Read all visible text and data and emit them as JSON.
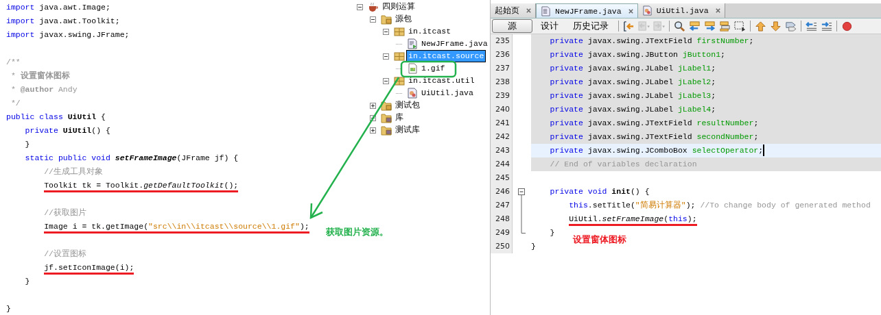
{
  "left_code": {
    "lines": [
      {
        "underlined": false,
        "tokens": [
          {
            "kind": "keyword",
            "text": "import"
          },
          {
            "kind": "text",
            "text": " java.awt.Image;"
          }
        ]
      },
      {
        "underlined": false,
        "tokens": [
          {
            "kind": "keyword",
            "text": "import"
          },
          {
            "kind": "text",
            "text": " java.awt.Toolkit;"
          }
        ]
      },
      {
        "underlined": false,
        "tokens": [
          {
            "kind": "keyword",
            "text": "import"
          },
          {
            "kind": "text",
            "text": " javax.swing.JFrame;"
          }
        ]
      },
      {
        "kind": "blank"
      },
      {
        "kind": "code",
        "underlined": false,
        "tokens": [
          {
            "kind": "comment",
            "text": "/**"
          }
        ]
      },
      {
        "underlined": false,
        "tokens": [
          {
            "kind": "comment",
            "text": " * "
          },
          {
            "kind": "comment-bold",
            "text": "设置窗体图标"
          }
        ]
      },
      {
        "underlined": false,
        "tokens": [
          {
            "kind": "comment",
            "text": " * "
          },
          {
            "kind": "comment-bold",
            "text": "@author"
          },
          {
            "kind": "comment",
            "text": " Andy"
          }
        ]
      },
      {
        "underlined": false,
        "tokens": [
          {
            "kind": "comment",
            "text": " */"
          }
        ]
      },
      {
        "underlined": false,
        "tokens": [
          {
            "kind": "keyword",
            "text": "public class "
          },
          {
            "kind": "bold",
            "text": "UiUtil"
          },
          {
            "kind": "text",
            "text": " {"
          }
        ]
      },
      {
        "underlined": false,
        "tokens": [
          {
            "kind": "keyword",
            "text": "    private "
          },
          {
            "kind": "bold",
            "text": "UiUtil"
          },
          {
            "kind": "text",
            "text": "() {"
          }
        ]
      },
      {
        "underlined": false,
        "tokens": [
          {
            "kind": "text",
            "text": "    }"
          }
        ]
      },
      {
        "underlined": false,
        "tokens": [
          {
            "kind": "keyword",
            "text": "    static public void "
          },
          {
            "kind": "bold-italic",
            "text": "setFrameImage"
          },
          {
            "kind": "text",
            "text": "(JFrame jf) {"
          }
        ]
      },
      {
        "underlined": false,
        "tokens": [
          {
            "kind": "comment",
            "text": "        //生成工具对象"
          }
        ]
      },
      {
        "underlined": true,
        "tokens": [
          {
            "kind": "text",
            "text": "        Toolkit tk = Toolkit."
          },
          {
            "kind": "italic",
            "text": "getDefaultToolkit"
          },
          {
            "kind": "text",
            "text": "();"
          }
        ]
      },
      {
        "kind": "blank"
      },
      {
        "kind": "code",
        "underlined": false,
        "tokens": [
          {
            "kind": "comment",
            "text": "        //获取图片"
          }
        ]
      },
      {
        "underlined": true,
        "tokens": [
          {
            "kind": "text",
            "text": "        Image i = tk.getImage("
          },
          {
            "kind": "string",
            "text": "\"src\\\\in\\\\itcast\\\\source\\\\1.gif\""
          },
          {
            "kind": "text",
            "text": ");"
          }
        ]
      },
      {
        "kind": "blank"
      },
      {
        "kind": "code",
        "underlined": false,
        "tokens": [
          {
            "kind": "comment",
            "text": "        //设置图标"
          }
        ]
      },
      {
        "underlined": true,
        "tokens": [
          {
            "kind": "text",
            "text": "        jf.setIconImage(i);"
          }
        ]
      },
      {
        "underlined": false,
        "tokens": [
          {
            "kind": "text",
            "text": "    }"
          }
        ]
      },
      {
        "kind": "blank"
      },
      {
        "kind": "code",
        "underlined": false,
        "tokens": [
          {
            "kind": "text",
            "text": "}"
          }
        ]
      }
    ]
  },
  "project_tree": [
    {
      "label": "四则运算",
      "kind": "project",
      "expanded": true,
      "selected": false,
      "children": [
        {
          "label": "源包",
          "kind": "source-folder",
          "expanded": true,
          "selected": false,
          "children": [
            {
              "label": "in.itcast",
              "kind": "package",
              "expanded": true,
              "selected": false,
              "children": [
                {
                  "label": "NewJFrame.java",
                  "kind": "form-file",
                  "selected": false
                }
              ]
            },
            {
              "label": "in.itcast.source",
              "kind": "package",
              "expanded": true,
              "selected": true,
              "children": [
                {
                  "label": "1.gif",
                  "kind": "image-file",
                  "selected": false
                }
              ]
            },
            {
              "label": "in.itcast.util",
              "kind": "package",
              "expanded": true,
              "selected": false,
              "children": [
                {
                  "label": "UiUtil.java",
                  "kind": "class-file",
                  "selected": false
                }
              ]
            }
          ]
        },
        {
          "label": "测试包",
          "kind": "source-folder",
          "expanded": false,
          "selected": false
        },
        {
          "label": "库",
          "kind": "library",
          "expanded": false,
          "selected": false
        },
        {
          "label": "测试库",
          "kind": "library",
          "expanded": false,
          "selected": false
        }
      ]
    }
  ],
  "editor": {
    "tabs": [
      {
        "label": "起始页",
        "kind": "page",
        "selected": false
      },
      {
        "label": "NewJFrame.java",
        "kind": "form-file",
        "selected": true
      },
      {
        "label": "UiUtil.java",
        "kind": "class-file",
        "selected": false
      }
    ],
    "views": [
      {
        "label": "源",
        "selected": true
      },
      {
        "label": "设计",
        "selected": false
      },
      {
        "label": "历史记录",
        "selected": false
      }
    ],
    "toolbar_buttons": [
      {
        "kind": "last-edit",
        "disabled": false
      },
      {
        "kind": "back",
        "disabled": true
      },
      {
        "kind": "forward",
        "disabled": true
      },
      {
        "kind": "find",
        "disabled": false
      },
      {
        "kind": "find-previous",
        "disabled": false
      },
      {
        "kind": "find-next",
        "disabled": false
      },
      {
        "kind": "highlight",
        "disabled": false
      },
      {
        "kind": "selection",
        "disabled": false
      },
      {
        "kind": "previous-bookmark",
        "disabled": false
      },
      {
        "kind": "next-bookmark",
        "disabled": false
      },
      {
        "kind": "toggle-bookmark",
        "disabled": false
      },
      {
        "kind": "shift-left",
        "disabled": false
      },
      {
        "kind": "shift-right",
        "disabled": false
      },
      {
        "kind": "record",
        "disabled": false
      }
    ],
    "lines": [
      {
        "number": "235",
        "shaded": true,
        "current": false,
        "underlined": false,
        "tokens": [
          {
            "kind": "keyword",
            "text": "    private"
          },
          {
            "kind": "text",
            "text": " javax.swing.JTextField "
          },
          {
            "kind": "field",
            "text": "firstNumber"
          },
          {
            "kind": "text",
            "text": ";"
          }
        ]
      },
      {
        "number": "236",
        "shaded": true,
        "current": false,
        "underlined": false,
        "tokens": [
          {
            "kind": "keyword",
            "text": "    private"
          },
          {
            "kind": "text",
            "text": " javax.swing.JButton "
          },
          {
            "kind": "field",
            "text": "jButton1"
          },
          {
            "kind": "text",
            "text": ";"
          }
        ]
      },
      {
        "number": "237",
        "shaded": true,
        "current": false,
        "underlined": false,
        "tokens": [
          {
            "kind": "keyword",
            "text": "    private"
          },
          {
            "kind": "text",
            "text": " javax.swing.JLabel "
          },
          {
            "kind": "field",
            "text": "jLabel1"
          },
          {
            "kind": "text",
            "text": ";"
          }
        ]
      },
      {
        "number": "238",
        "shaded": true,
        "current": false,
        "underlined": false,
        "tokens": [
          {
            "kind": "keyword",
            "text": "    private"
          },
          {
            "kind": "text",
            "text": " javax.swing.JLabel "
          },
          {
            "kind": "field",
            "text": "jLabel2"
          },
          {
            "kind": "text",
            "text": ";"
          }
        ]
      },
      {
        "number": "239",
        "shaded": true,
        "current": false,
        "underlined": false,
        "tokens": [
          {
            "kind": "keyword",
            "text": "    private"
          },
          {
            "kind": "text",
            "text": " javax.swing.JLabel "
          },
          {
            "kind": "field",
            "text": "jLabel3"
          },
          {
            "kind": "text",
            "text": ";"
          }
        ]
      },
      {
        "number": "240",
        "shaded": true,
        "current": false,
        "underlined": false,
        "tokens": [
          {
            "kind": "keyword",
            "text": "    private"
          },
          {
            "kind": "text",
            "text": " javax.swing.JLabel "
          },
          {
            "kind": "field",
            "text": "jLabel4"
          },
          {
            "kind": "text",
            "text": ";"
          }
        ]
      },
      {
        "number": "241",
        "shaded": true,
        "current": false,
        "underlined": false,
        "tokens": [
          {
            "kind": "keyword",
            "text": "    private"
          },
          {
            "kind": "text",
            "text": " javax.swing.JTextField "
          },
          {
            "kind": "field",
            "text": "resultNumber"
          },
          {
            "kind": "text",
            "text": ";"
          }
        ]
      },
      {
        "number": "242",
        "shaded": true,
        "current": false,
        "underlined": false,
        "tokens": [
          {
            "kind": "keyword",
            "text": "    private"
          },
          {
            "kind": "text",
            "text": " javax.swing.JTextField "
          },
          {
            "kind": "field",
            "text": "secondNumber"
          },
          {
            "kind": "text",
            "text": ";"
          }
        ]
      },
      {
        "number": "243",
        "shaded": true,
        "current": true,
        "underlined": false,
        "tokens": [
          {
            "kind": "keyword",
            "text": "    private"
          },
          {
            "kind": "text",
            "text": " javax.swing.JComboBox "
          },
          {
            "kind": "field",
            "text": "selectOperator"
          },
          {
            "kind": "text",
            "text": ";"
          }
        ]
      },
      {
        "number": "244",
        "shaded": true,
        "current": false,
        "underlined": false,
        "tokens": [
          {
            "kind": "comment",
            "text": "    // End of variables declaration"
          }
        ]
      },
      {
        "number": "245",
        "shaded": false,
        "current": false
      },
      {
        "number": "246",
        "shaded": false,
        "current": false,
        "underlined": false,
        "kind": "fold-start",
        "tokens": [
          {
            "kind": "keyword",
            "text": "    private void "
          },
          {
            "kind": "bold",
            "text": "init"
          },
          {
            "kind": "text",
            "text": "() {"
          }
        ]
      },
      {
        "number": "247",
        "shaded": false,
        "current": false,
        "underlined": false,
        "kind": "fold-body",
        "tokens": [
          {
            "kind": "keyword",
            "text": "        this"
          },
          {
            "kind": "text",
            "text": ".setTitle("
          },
          {
            "kind": "string",
            "text": "\"简易计算器\""
          },
          {
            "kind": "text",
            "text": "); "
          },
          {
            "kind": "comment",
            "text": "//To change body of generated method"
          }
        ]
      },
      {
        "number": "248",
        "shaded": false,
        "current": false,
        "underlined": true,
        "kind": "fold-body",
        "tokens": [
          {
            "kind": "text",
            "text": "        UiUtil."
          },
          {
            "kind": "italic",
            "text": "setFrameImage"
          },
          {
            "kind": "text",
            "text": "("
          },
          {
            "kind": "keyword",
            "text": "this"
          },
          {
            "kind": "text",
            "text": ");"
          }
        ]
      },
      {
        "number": "249",
        "shaded": false,
        "current": false,
        "underlined": false,
        "kind": "fold-end",
        "tokens": [
          {
            "kind": "text",
            "text": "    }"
          }
        ]
      },
      {
        "number": "250",
        "shaded": false,
        "current": false,
        "underlined": false,
        "tokens": [
          {
            "kind": "text",
            "text": "}"
          }
        ]
      }
    ]
  },
  "annotations": [
    {
      "text": "获取图片资源。",
      "color": "#22b14c"
    },
    {
      "text": "设置窗体图标",
      "color": "#ed1c24"
    }
  ]
}
